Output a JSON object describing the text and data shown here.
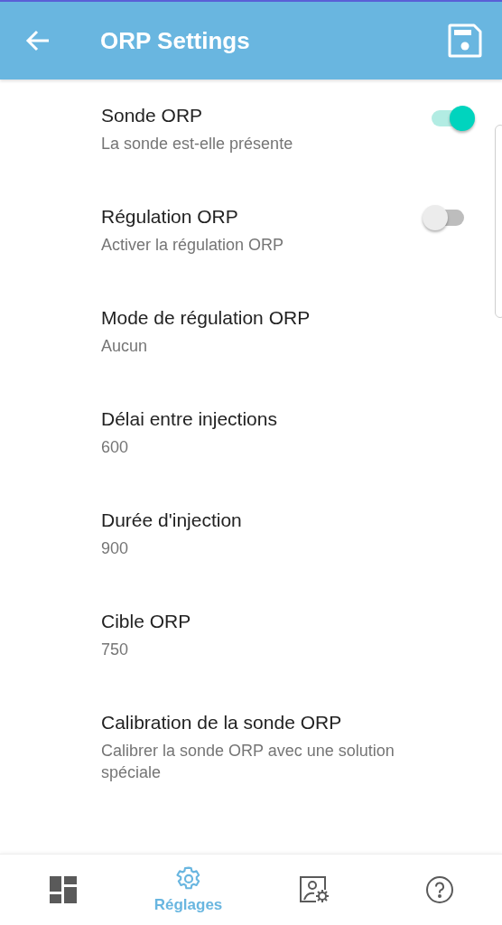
{
  "header": {
    "title": "ORP Settings"
  },
  "settings": [
    {
      "kind": "switch",
      "title": "Sonde ORP",
      "subtitle": "La sonde est-elle présente",
      "on": true
    },
    {
      "kind": "switch",
      "title": "Régulation ORP",
      "subtitle": "Activer la régulation ORP",
      "on": false
    },
    {
      "kind": "value",
      "title": "Mode de régulation ORP",
      "subtitle": "Aucun"
    },
    {
      "kind": "value",
      "title": "Délai entre injections",
      "subtitle": "600"
    },
    {
      "kind": "value",
      "title": "Durée d'injection",
      "subtitle": "900"
    },
    {
      "kind": "value",
      "title": "Cible ORP",
      "subtitle": "750"
    },
    {
      "kind": "value",
      "title": "Calibration de la sonde ORP",
      "subtitle": "Calibrer la sonde ORP avec une solution spéciale"
    }
  ],
  "nav": [
    {
      "kind": "dashboard",
      "selected": false
    },
    {
      "kind": "settings",
      "label": "Réglages",
      "selected": true
    },
    {
      "kind": "image-settings",
      "selected": false
    },
    {
      "kind": "help",
      "selected": false
    }
  ]
}
